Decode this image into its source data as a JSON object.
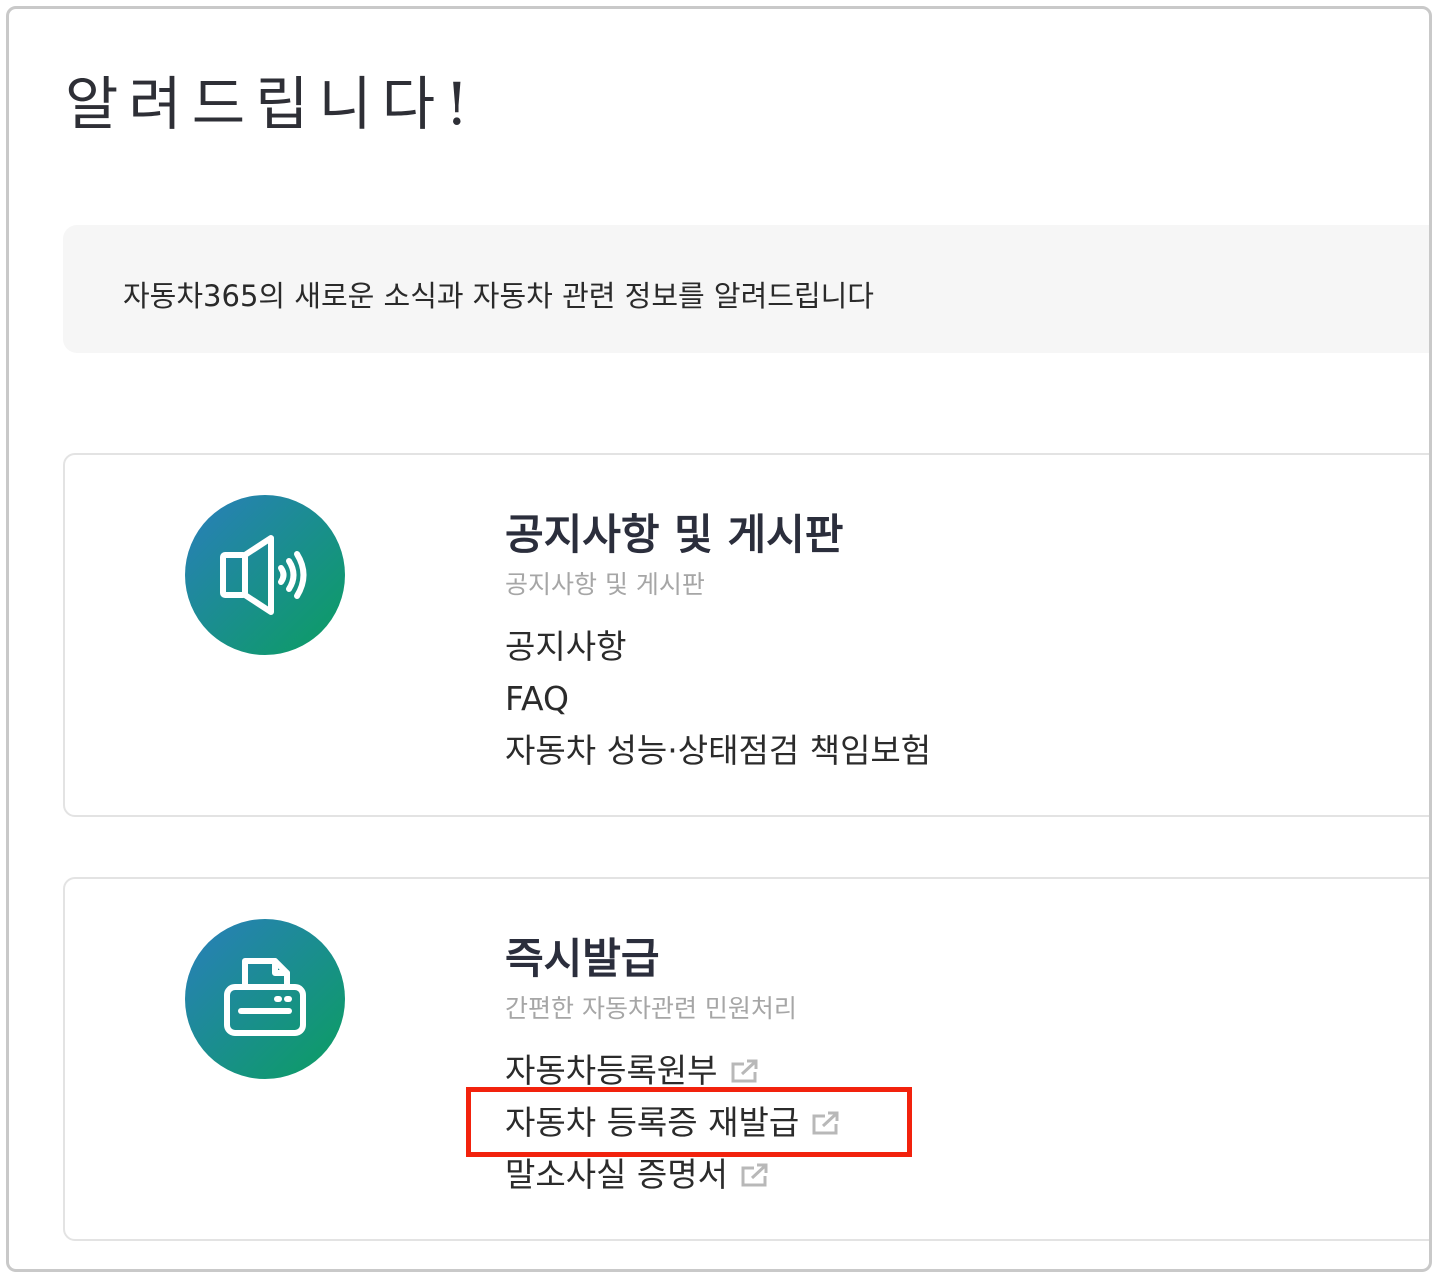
{
  "page": {
    "title": "알려드립니다!",
    "intro": "자동차365의 새로운 소식과 자동차 관련 정보를 알려드립니다"
  },
  "cards": [
    {
      "icon": "speaker-icon",
      "title": "공지사항 및 게시판",
      "subtitle": "공지사항 및 게시판",
      "links": [
        {
          "label": "공지사항",
          "external": false
        },
        {
          "label": "FAQ",
          "external": false
        },
        {
          "label": "자동차 성능·상태점검 책임보험",
          "external": false
        }
      ]
    },
    {
      "icon": "printer-icon",
      "title": "즉시발급",
      "subtitle": "간편한 자동차관련 민원처리",
      "links": [
        {
          "label": "자동차등록원부",
          "external": true,
          "icon": "external-link-icon"
        },
        {
          "label": "자동차 등록증 재발급",
          "external": true,
          "icon": "external-link-icon"
        },
        {
          "label": "말소사실 증명서",
          "external": true,
          "icon": "external-link-icon"
        }
      ]
    }
  ],
  "highlight": {
    "target": "자동차 등록증 재발급",
    "color": "#f2220d"
  },
  "colors": {
    "badge_start": "#2a7ebc",
    "badge_end": "#0b9e60",
    "intro_bg": "#f6f6f6"
  }
}
